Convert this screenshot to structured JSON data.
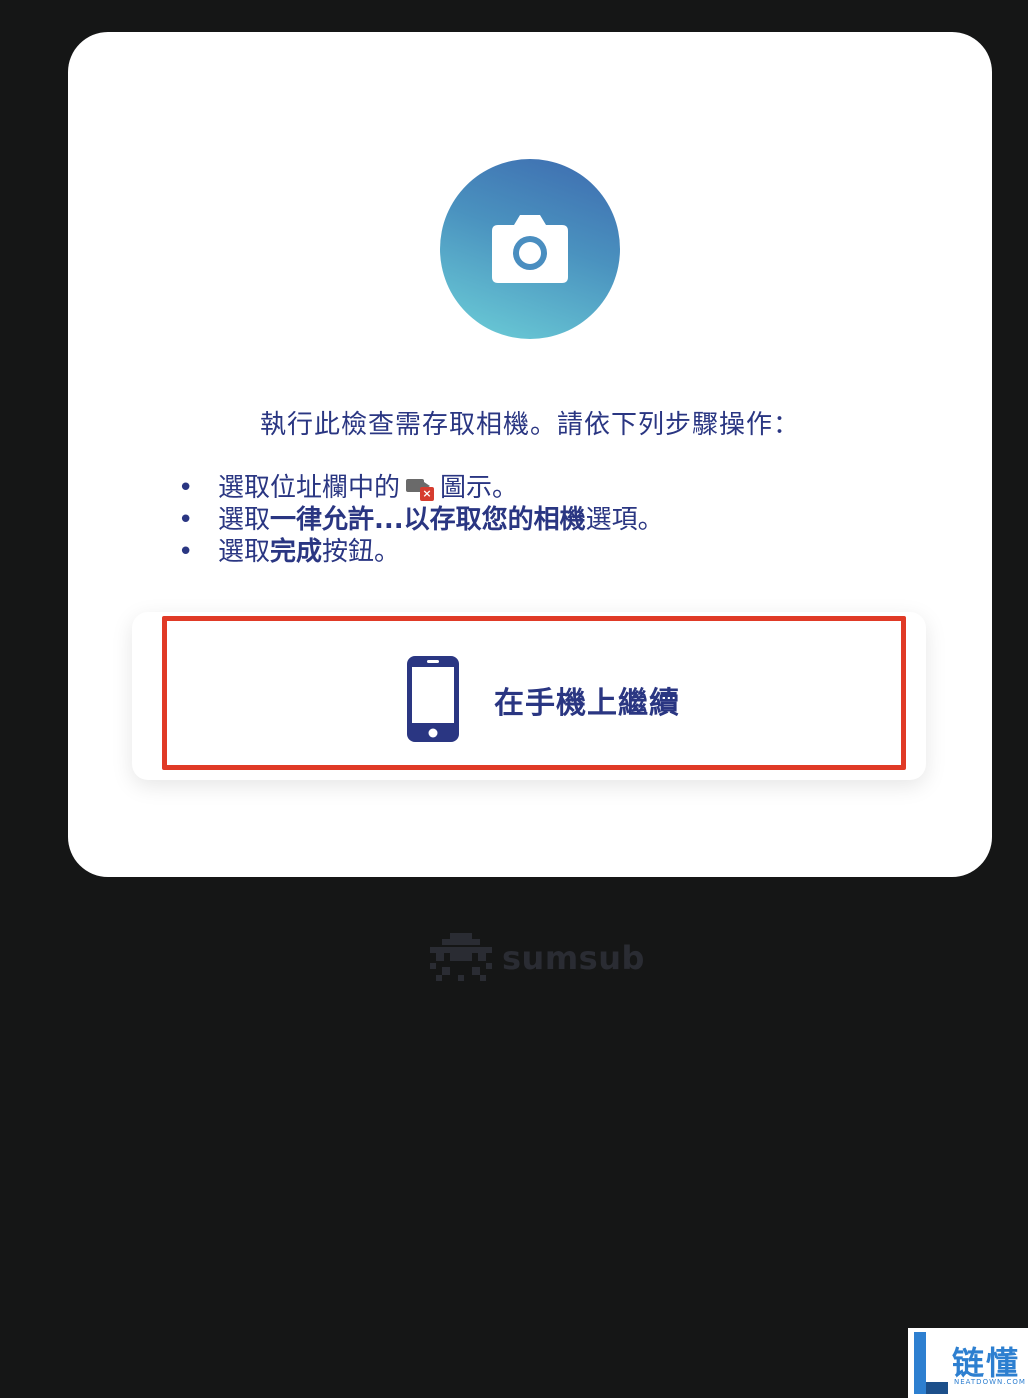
{
  "instruction": "執行此檢查需存取相機。請依下列步驟操作：",
  "steps": [
    {
      "bullet": "•",
      "prefix": "選取位址欄中的",
      "icon": "camera-blocked-icon",
      "suffix": "圖示。"
    },
    {
      "bullet": "•",
      "prefix": "選取",
      "bold": "一律允許...以存取您的相機",
      "suffix": "選項。"
    },
    {
      "bullet": "•",
      "prefix": "選取",
      "bold": "完成",
      "suffix": "按鈕。"
    }
  ],
  "continue_button": {
    "label": "在手機上繼續",
    "icon": "smartphone-icon"
  },
  "header_icon": "camera-icon",
  "site_icon_badge": "×",
  "brand": {
    "name": "sumsub",
    "logo": "sumsub-logo-icon"
  },
  "watermark": {
    "text": "链懂",
    "subtext": "NEATDOWN.COM"
  },
  "colors": {
    "background": "#151616",
    "card": "#ffffff",
    "text": "#2a3682",
    "highlight": "#e03a26",
    "gradient_top": "#3d6aaf",
    "gradient_bottom": "#6dd0d8",
    "brand": "#2a2c33",
    "watermark": "#2d7fd0"
  }
}
